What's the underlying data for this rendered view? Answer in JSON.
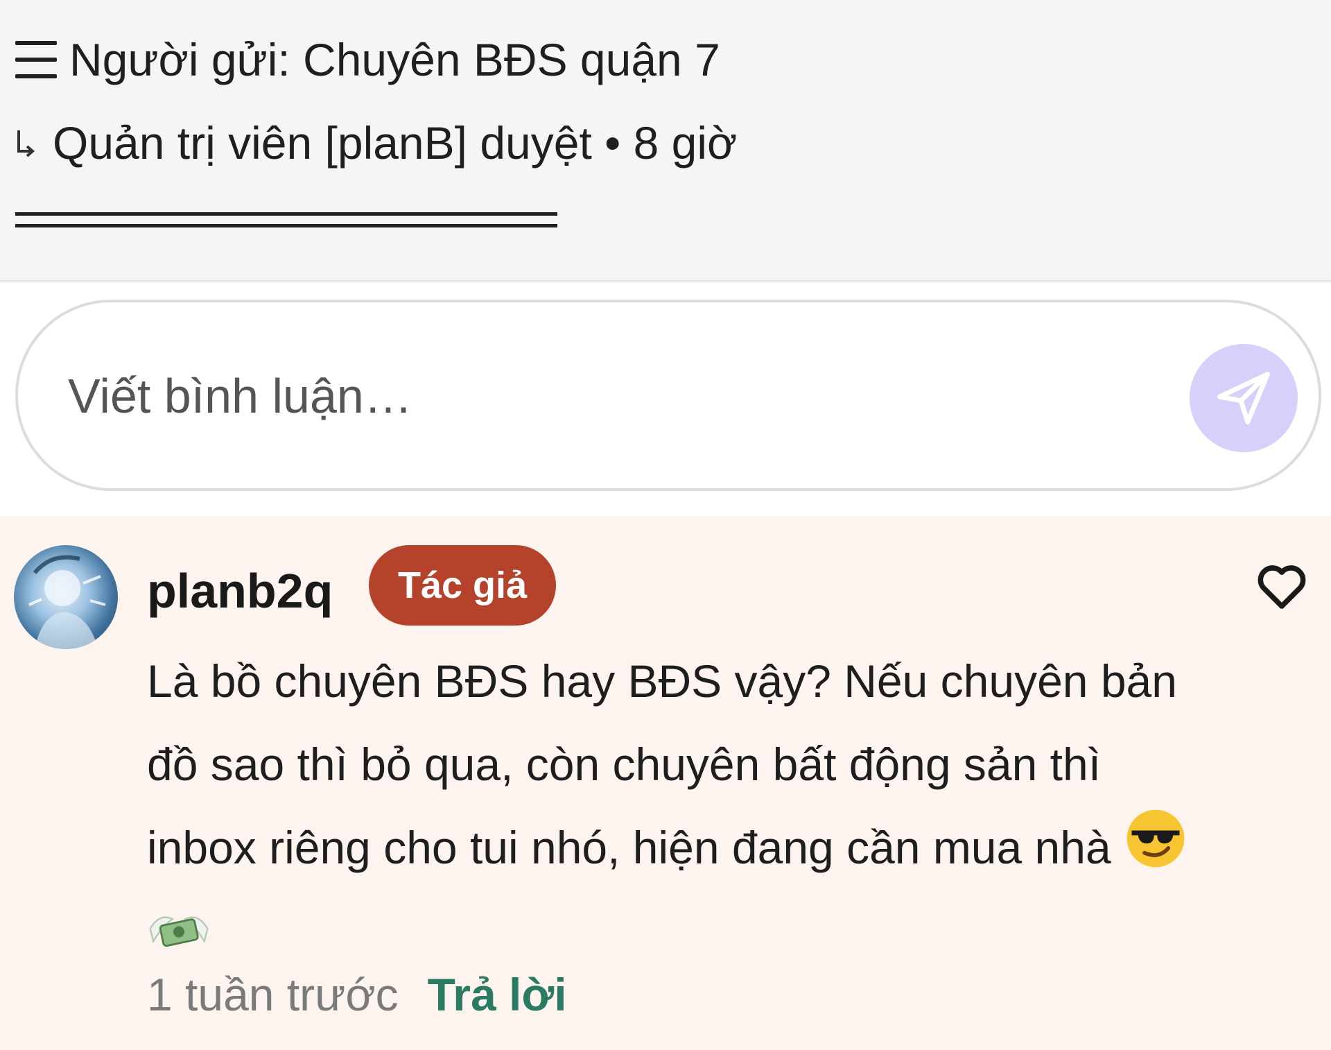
{
  "post": {
    "sender_line": "Người gửi: Chuyên BĐS quận 7",
    "moderator_line": "Quản trị viên [planB] duyệt • 8 giờ"
  },
  "comment_input": {
    "placeholder": "Viết bình luận…"
  },
  "comment": {
    "username": "planb2q",
    "badge": "Tác giả",
    "text": "Là bồ chuyên BĐS hay BĐS vậy? Nếu chuyên bản đồ sao thì bỏ qua, còn chuyên bất động sản thì inbox riêng cho tui nhó, hiện đang cần mua nhà",
    "emojis": [
      "sunglasses-face-emoji",
      "money-with-wings-emoji"
    ],
    "timestamp": "1 tuần trước",
    "reply_label": "Trả lời"
  },
  "icons": {
    "menu": "menu-icon",
    "return_arrow": "return-arrow-icon",
    "send": "send-icon",
    "heart": "heart-icon"
  },
  "colors": {
    "send_button_bg": "#d8d0fa",
    "author_badge_bg": "#b5432b",
    "reply_link": "#2b7a62",
    "comment_bg": "#fdf3ef"
  }
}
